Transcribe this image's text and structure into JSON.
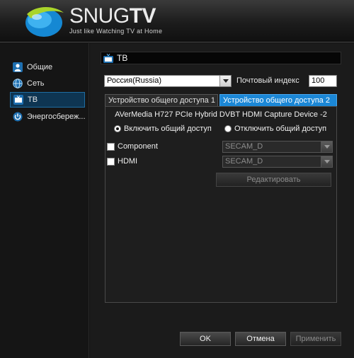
{
  "app": {
    "brand_prefix": "SNUG",
    "brand_suffix": "TV",
    "tagline": "Just like Watching TV at Home"
  },
  "sidebar": {
    "items": [
      {
        "label": "Общие",
        "icon": "user-icon"
      },
      {
        "label": "Сеть",
        "icon": "globe-icon"
      },
      {
        "label": "ТВ",
        "icon": "tv-icon",
        "active": true
      },
      {
        "label": "Энергосбереж...",
        "icon": "power-icon"
      }
    ]
  },
  "page": {
    "title": "ТВ"
  },
  "region": {
    "country_value": "Россия(Russia)",
    "postal_label": "Почтовый индекс",
    "postal_value": "100"
  },
  "tabs": [
    {
      "label": "Устройство общего доступа 1",
      "active": false
    },
    {
      "label": "Устройство общего доступа 2",
      "active": true
    }
  ],
  "device": {
    "name": "AVerMedia H727 PCIe Hybrid DVBT HDMI Capture Device -2",
    "enable_label": "Включить общий доступ",
    "disable_label": "Отключить общий доступ",
    "selected": "enable"
  },
  "inputs": [
    {
      "label": "Component",
      "checked": false,
      "standard": "SECAM_D"
    },
    {
      "label": "HDMI",
      "checked": false,
      "standard": "SECAM_D"
    }
  ],
  "edit_button": "Редактировать",
  "footer": {
    "ok": "OK",
    "cancel": "Отмена",
    "apply": "Применить"
  },
  "colors": {
    "accent": "#1b87d6",
    "active_nav": "#0e3552",
    "background": "#1b1b1b"
  }
}
